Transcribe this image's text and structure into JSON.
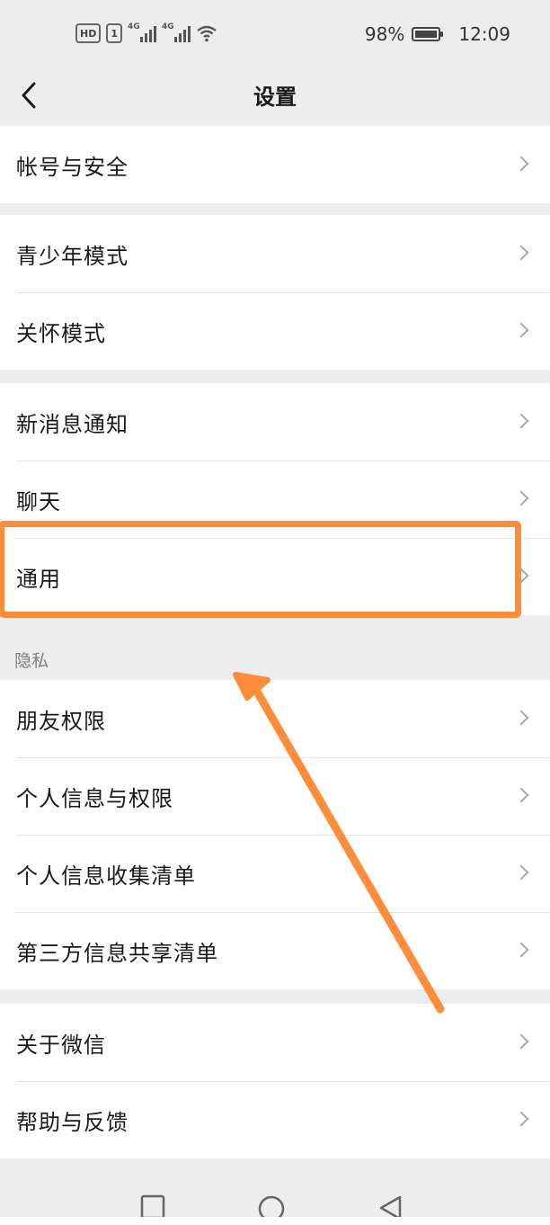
{
  "status_bar": {
    "hd_badge": "HD",
    "sim_badge": "1",
    "net1": "4G",
    "net2": "4G",
    "battery_percent": "98%",
    "time": "12:09"
  },
  "nav": {
    "title": "设置"
  },
  "groups": [
    {
      "items": [
        "帐号与安全"
      ]
    },
    {
      "items": [
        "青少年模式",
        "关怀模式"
      ]
    },
    {
      "items": [
        "新消息通知",
        "聊天",
        "通用"
      ]
    },
    {
      "header": "隐私",
      "items": [
        "朋友权限",
        "个人信息与权限",
        "个人信息收集清单",
        "第三方信息共享清单"
      ]
    },
    {
      "items": [
        "关于微信",
        "帮助与反馈"
      ]
    }
  ],
  "annotation": {
    "highlight_color": "#fd8c3b",
    "highlighted_item": "通用"
  }
}
